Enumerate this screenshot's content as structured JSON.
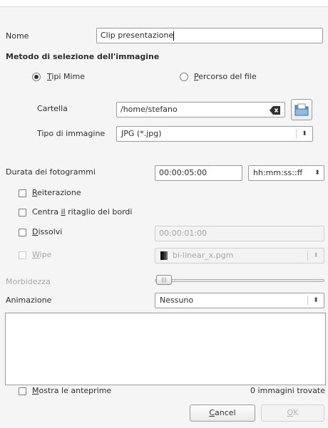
{
  "name": {
    "label": "Nome",
    "value": "Clip presentazione"
  },
  "method": {
    "heading": "Metodo di selezione dell'immagine",
    "mime": {
      "mnemonic": "T",
      "rest": "ipi Mime",
      "selected": true
    },
    "path": {
      "mnemonic": "P",
      "rest": "ercorso del file",
      "selected": false
    }
  },
  "folder": {
    "label": "Cartella",
    "value": "/home/stefano",
    "clear_icon": "clear-text-icon",
    "browse_icon": "open-folder-icon"
  },
  "image_type": {
    "label": "Tipo di immagine",
    "value": "JPG (*.jpg)"
  },
  "frame_duration": {
    "label": "Durata dei fotogrammi",
    "value": "00:00:05:00",
    "format": "hh:mm:ss::ff"
  },
  "loop": {
    "mnemonic": "R",
    "rest": "eiterazione",
    "checked": false
  },
  "center_crop": {
    "before": "Centra ",
    "mnemonic": "il",
    "after": " ritaglio dei bordi",
    "checked": false
  },
  "dissolve": {
    "mnemonic": "D",
    "rest": "issolvi",
    "checked": false,
    "duration": "00:00:01:00"
  },
  "wipe": {
    "mnemonic": "W",
    "rest": "ipe",
    "checked": false,
    "file": "bi-linear_x.pgm"
  },
  "softness": {
    "label": "Morbidezza",
    "level": 0
  },
  "animation": {
    "label": "Animazione",
    "value": "Nessuno"
  },
  "preview": {
    "mnemonic": "M",
    "rest": "ostra le anteprime",
    "checked": false,
    "count_text": "0 immagini trovate"
  },
  "buttons": {
    "cancel": {
      "mnemonic": "C",
      "rest": "ancel"
    },
    "ok": {
      "mnemonic": "O",
      "rest": "K",
      "enabled": false
    }
  },
  "colors": {
    "dialog_bg": "#f5f5f5",
    "border": "#9c9c9c",
    "disabled": "#a6a6a6"
  }
}
